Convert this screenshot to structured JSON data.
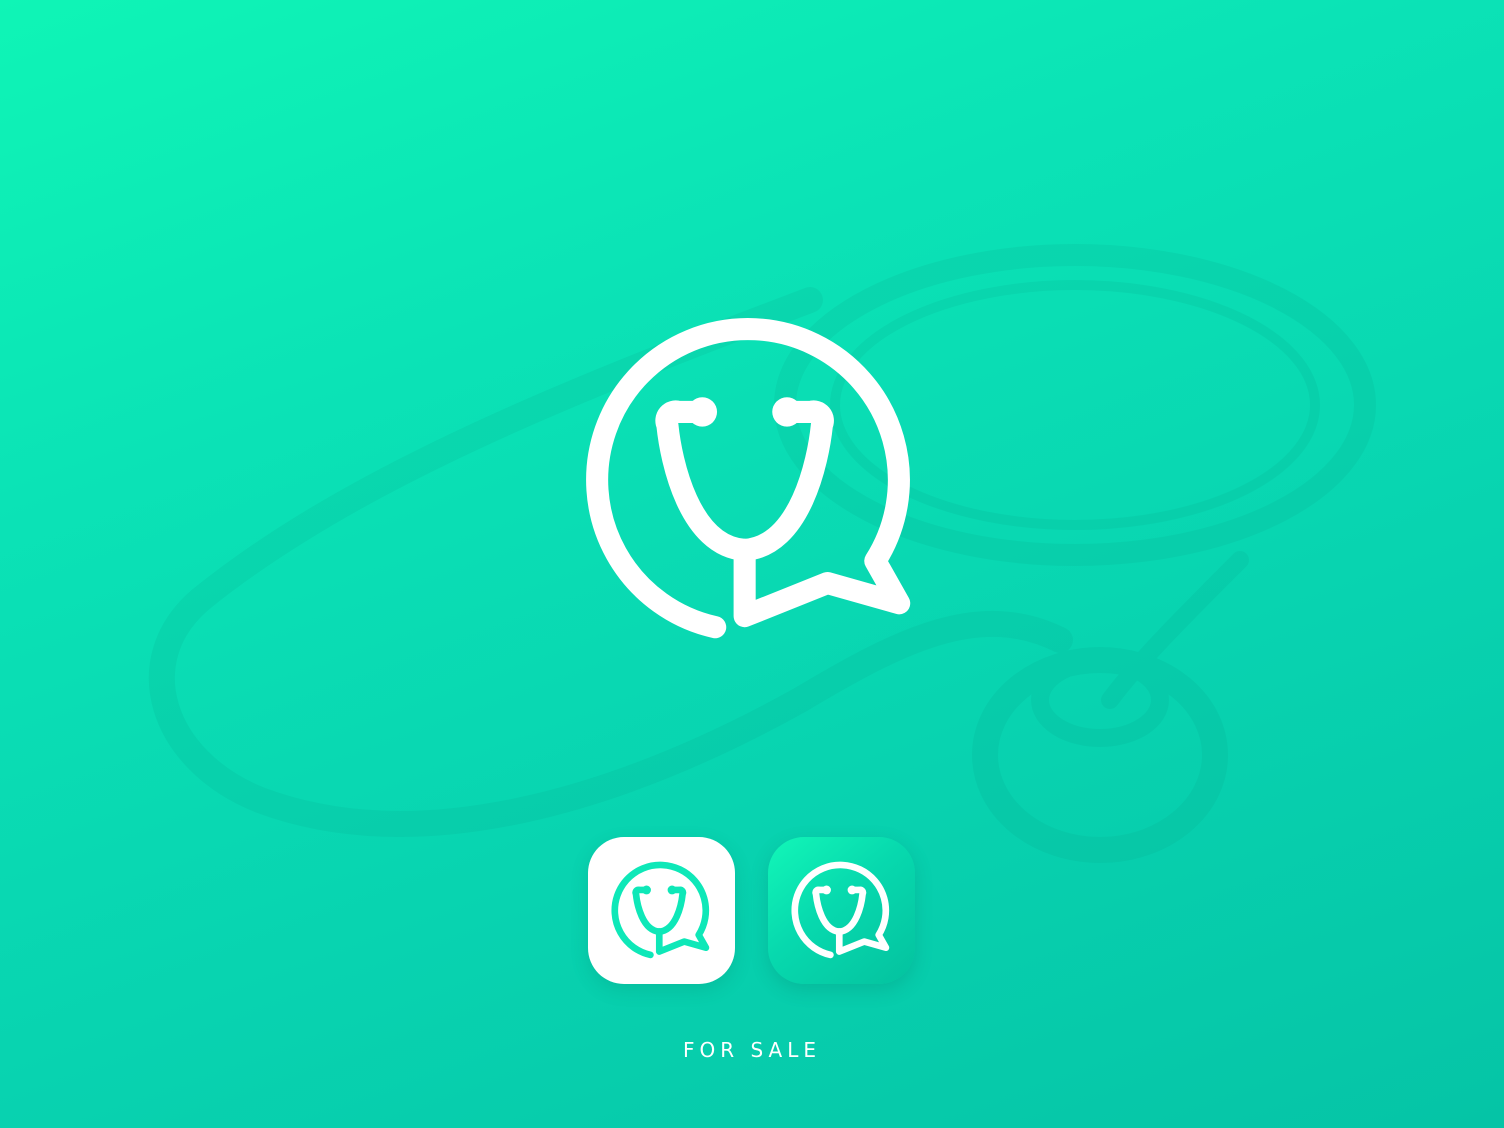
{
  "footer": {
    "label": "FOR SALE"
  },
  "logo": {
    "icon": "stethoscope-chat-bubble-icon",
    "stroke_color": "#ffffff"
  },
  "app_icons": [
    {
      "variant": "light",
      "background": "#ffffff",
      "glyph_color": "#0ee8b8"
    },
    {
      "variant": "gradient",
      "background": "#07d9ae",
      "glyph_color": "#ffffff"
    }
  ],
  "colors": {
    "background_start": "#0ff5b6",
    "background_end": "#05c4a6",
    "text": "#ffffff"
  }
}
